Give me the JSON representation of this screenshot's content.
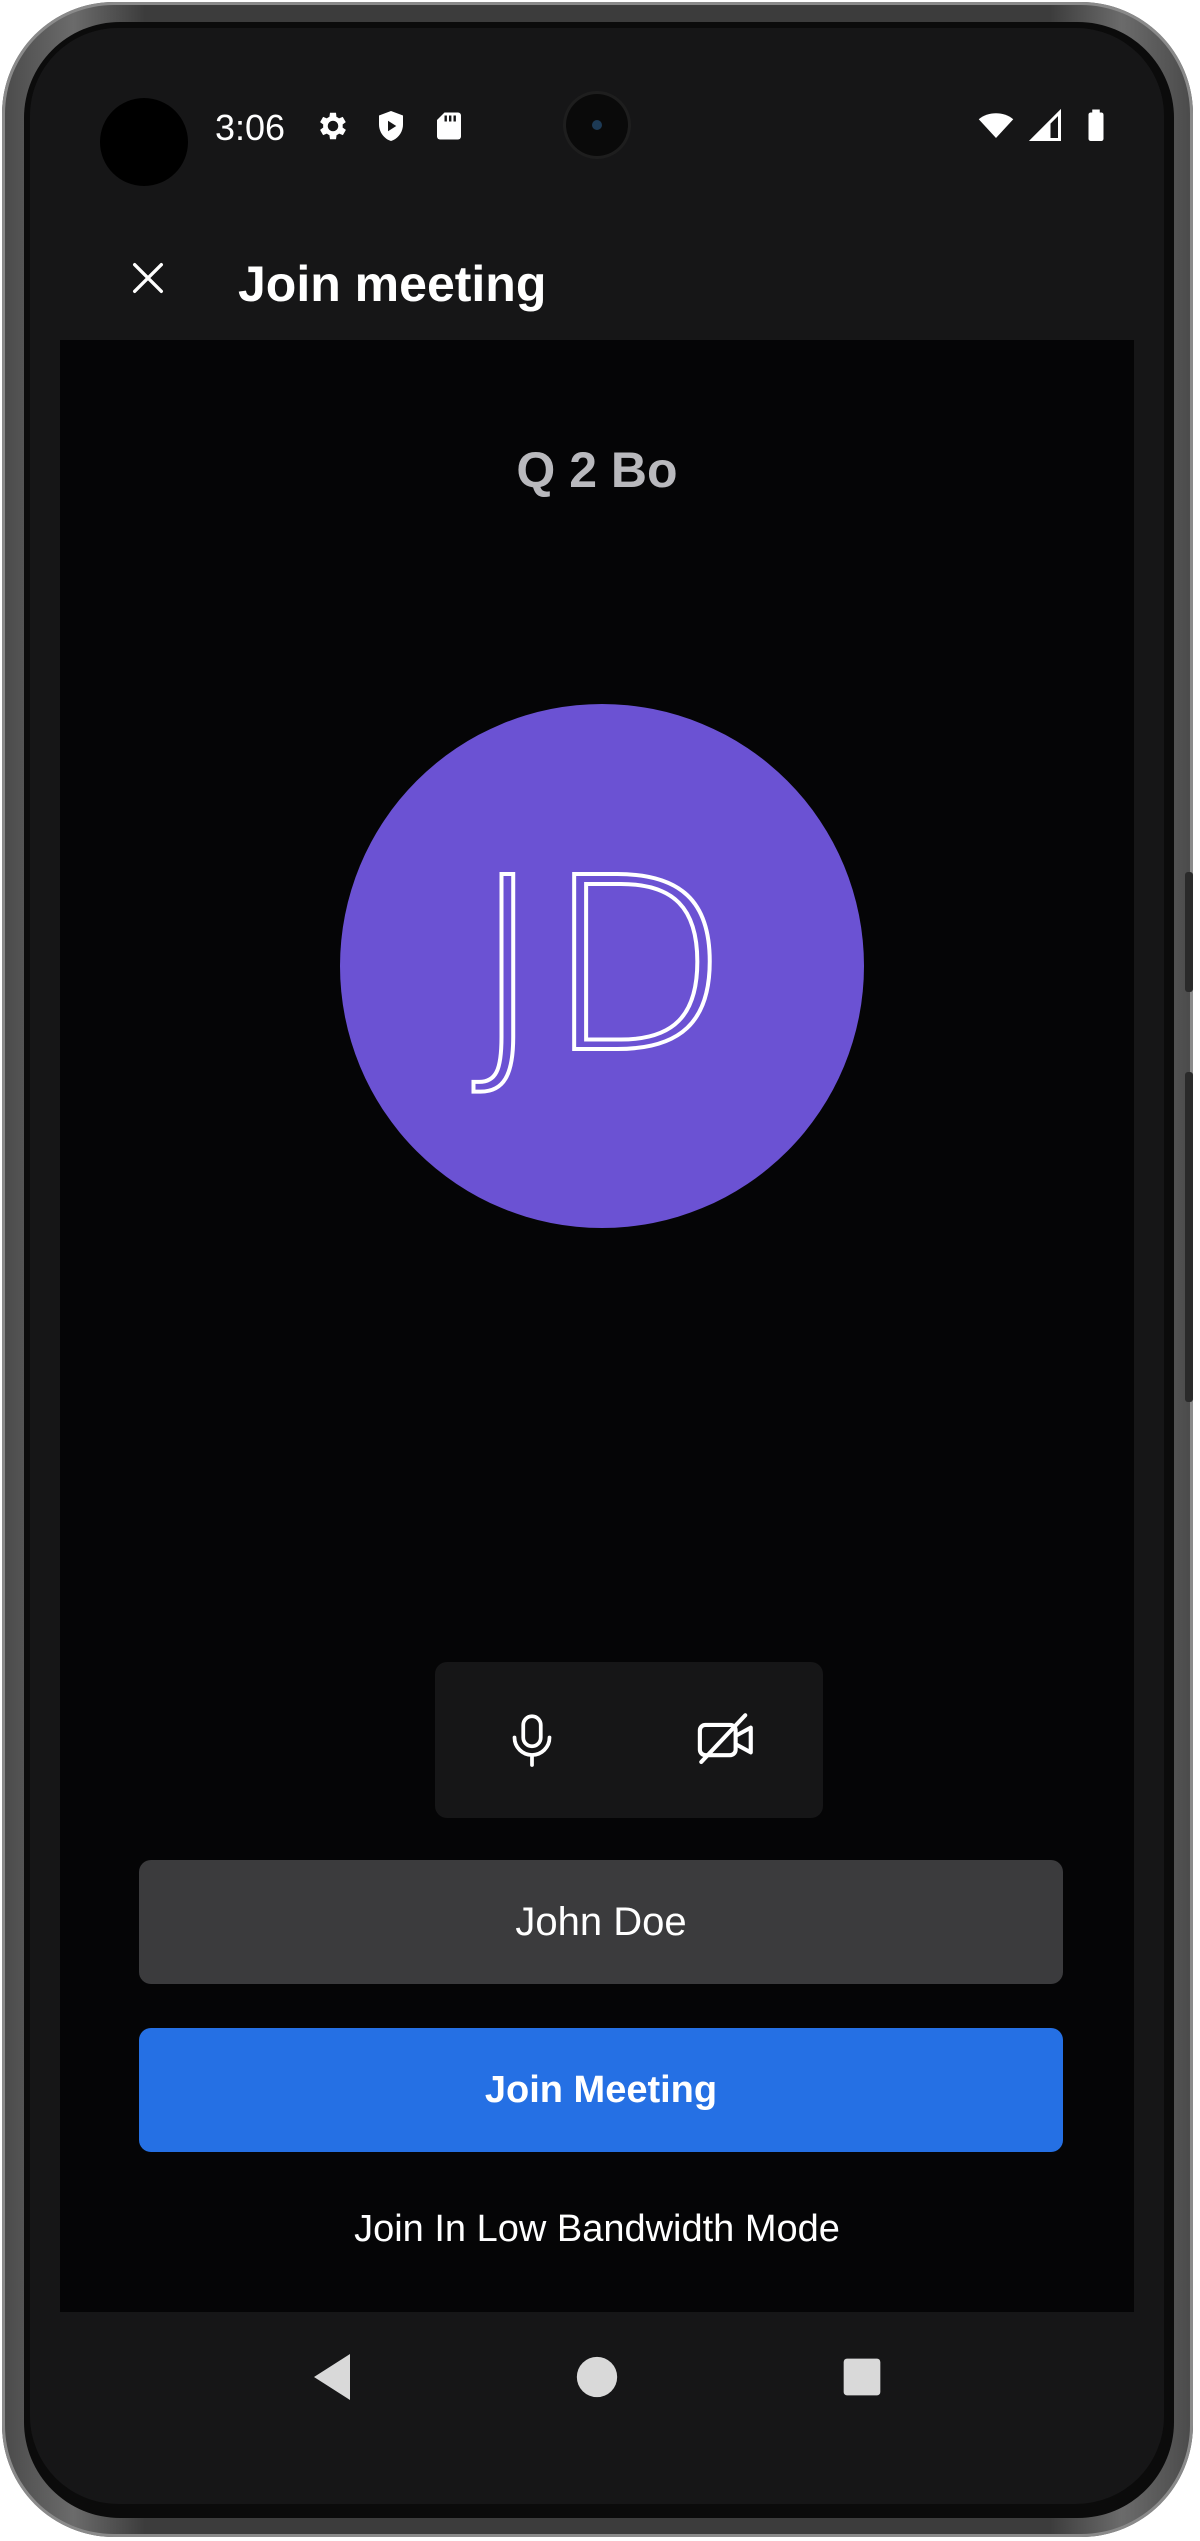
{
  "status_bar": {
    "time": "3:06",
    "left_icons": [
      "gear-icon",
      "shield-play-icon",
      "sd-card-icon"
    ],
    "right_icons": [
      "wifi-icon",
      "signal-icon",
      "battery-icon"
    ]
  },
  "app_bar": {
    "title": "Join meeting",
    "close_icon": "close-icon"
  },
  "meeting": {
    "name": "Q 2 Bo"
  },
  "avatar": {
    "initials": "JD",
    "color": "#6b52d3"
  },
  "media_controls": {
    "mic_icon": "microphone-icon",
    "camera_icon": "camera-off-icon"
  },
  "form": {
    "display_name": "John Doe",
    "join_button_label": "Join Meeting",
    "join_button_color": "#2570e4",
    "low_bandwidth_label": "Join In Low Bandwidth Mode"
  },
  "nav_bar": {
    "icons": [
      "back-icon",
      "home-icon",
      "recents-icon"
    ]
  }
}
